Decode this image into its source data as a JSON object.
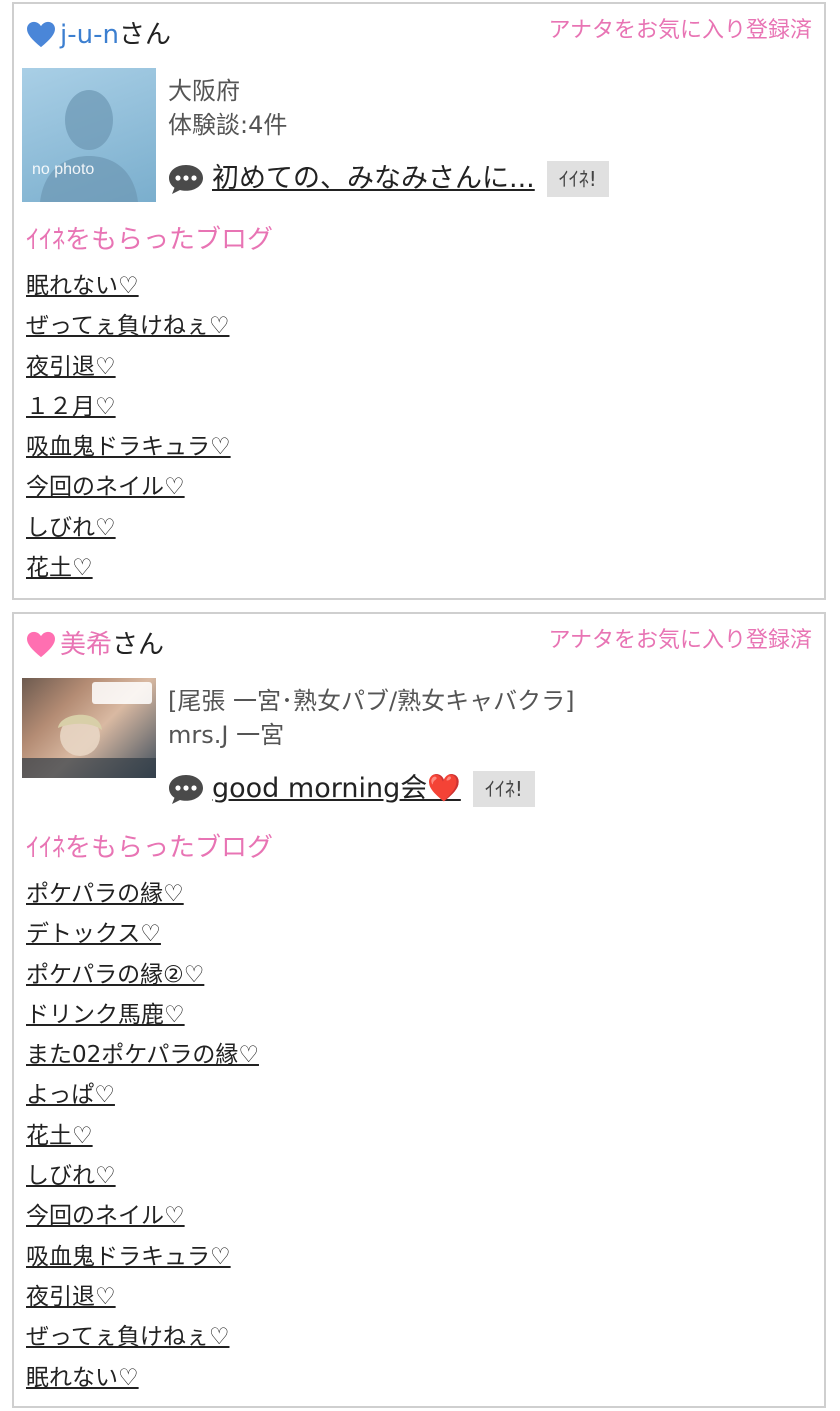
{
  "posts": [
    {
      "user_name": "j-u-n",
      "name_color": "#3c7fd0",
      "heart_color": "#4a86d8",
      "honorific": "さん",
      "favorite_status": "アナタをお気に入り登録済",
      "avatar_text": "no photo",
      "info_lines": [
        "大阪府",
        "体験談:4件"
      ],
      "comment": "初めての、みなみさんに...",
      "like_label": "ｲｲﾈ!",
      "blogs_heading": "ｲｲﾈをもらったブログ",
      "blogs": [
        "眠れない♡",
        "ぜってぇ負けねぇ♡",
        "夜引退♡",
        "１２月♡",
        "吸血鬼ドラキュラ♡",
        "今回のネイル♡",
        "しびれ♡",
        "花土♡"
      ]
    },
    {
      "user_name": "美希",
      "name_color": "#e874b4",
      "heart_color": "#ff6fb1",
      "honorific": "さん",
      "favorite_status": "アナタをお気に入り登録済",
      "info_lines": [
        "[尾張 一宮･熟女パブ/熟女キャバクラ]",
        "mrs.J 一宮"
      ],
      "comment": "good morning会❤️",
      "like_label": "ｲｲﾈ!",
      "blogs_heading": "ｲｲﾈをもらったブログ",
      "blogs": [
        "ポケパラの縁♡",
        "デトックス♡",
        "ポケパラの縁②♡",
        "ドリンク馬鹿♡",
        "また02ポケパラの縁♡",
        "よっぱ♡",
        "花土♡",
        "しびれ♡",
        "今回のネイル♡",
        "吸血鬼ドラキュラ♡",
        "夜引退♡",
        "ぜってぇ負けねぇ♡",
        "眠れない♡"
      ]
    }
  ]
}
